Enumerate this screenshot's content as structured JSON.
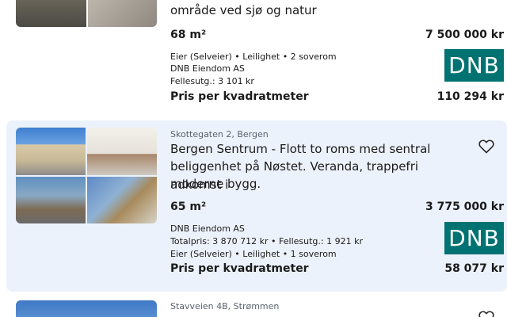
{
  "listings": [
    {
      "title_tail": "område ved sjø og natur",
      "size": "68 m²",
      "price": "7 500 000 kr",
      "info_lines": [
        "Eier (Selveier) • Leilighet • 2 soverom",
        "DNB Eiendom AS",
        "Fellesutg.: 3 101 kr"
      ],
      "sqm_label": "Pris per kvadratmeter",
      "sqm_value": "110 294 kr",
      "logo": "DNB"
    },
    {
      "address": "Skottegaten 2, Bergen",
      "title_lines": [
        "Bergen Sentrum - Flott to roms med sentral",
        "beliggenhet på Nøstet. Veranda, trappefri adkomst i",
        "moderne bygg."
      ],
      "size": "65 m²",
      "price": "3 775 000 kr",
      "info_lines": [
        "DNB Eiendom AS",
        "Totalpris: 3 870 712 kr • Fellesutg.: 1 921 kr",
        "Eier (Selveier) • Leilighet • 1 soverom"
      ],
      "sqm_label": "Pris per kvadratmeter",
      "sqm_value": "58 077 kr",
      "logo": "DNB",
      "favorite_icon": "heart-outline-icon"
    },
    {
      "address": "Stavveien 4B, Strømmen",
      "favorite_icon": "heart-outline-icon"
    }
  ],
  "colors": {
    "selected_bg": "#ecf2fb",
    "dnb_green": "#007272",
    "text": "#1b1b1b",
    "muted": "#5b6270"
  }
}
